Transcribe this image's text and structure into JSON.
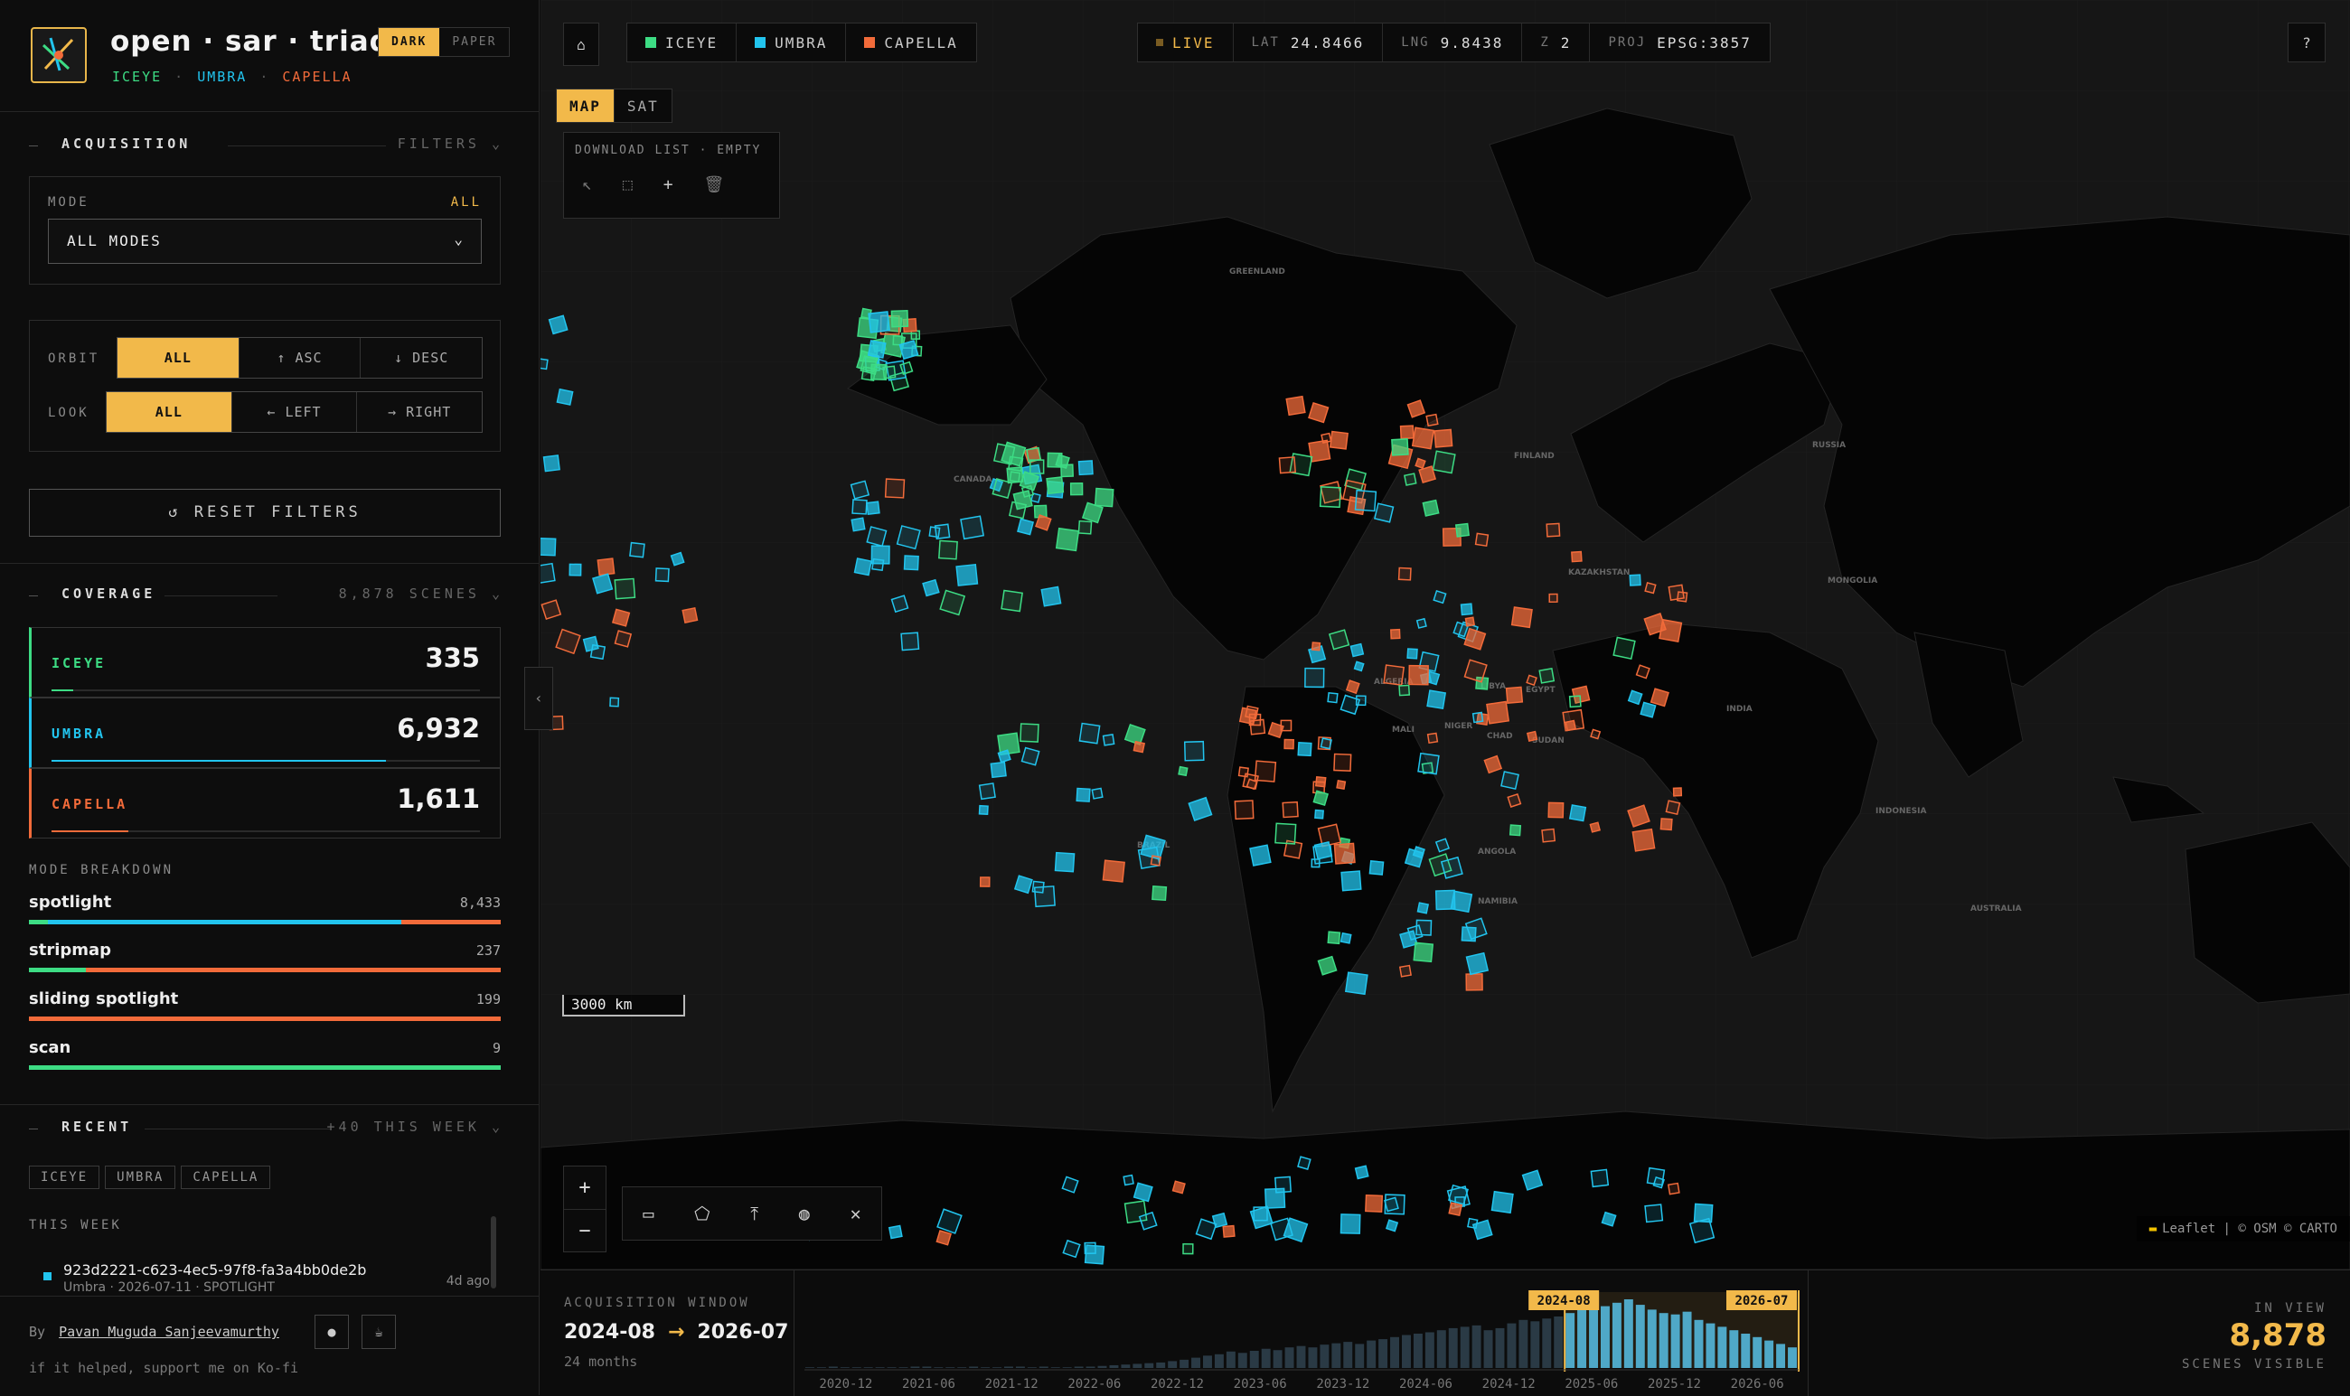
{
  "app": {
    "title": "open · sar · triad",
    "theme_dark": "DARK",
    "theme_paper": "PAPER",
    "providers": [
      "ICEYE",
      "UMBRA",
      "CAPELLA"
    ]
  },
  "colors": {
    "iceye": "#3ddc84",
    "umbra": "#22c4ee",
    "capella": "#f26b3a",
    "accent": "#f2b94a"
  },
  "acquisition": {
    "header": "ACQUISITION",
    "filters": "FILTERS",
    "mode_label": "MODE",
    "mode_all": "ALL",
    "mode_value": "ALL MODES",
    "orbit_label": "ORBIT",
    "orbit_options": [
      "ALL",
      "↑ ASC",
      "↓ DESC"
    ],
    "look_label": "LOOK",
    "look_options": [
      "ALL",
      "← LEFT",
      "→ RIGHT"
    ],
    "reset": "↺ RESET FILTERS"
  },
  "coverage": {
    "header": "COVERAGE",
    "scenes": "8,878 SCENES",
    "rows": [
      {
        "name": "ICEYE",
        "value": "335"
      },
      {
        "name": "UMBRA",
        "value": "6,932"
      },
      {
        "name": "CAPELLA",
        "value": "1,611"
      }
    ]
  },
  "modes": {
    "header": "MODE BREAKDOWN",
    "rows": [
      {
        "name": "spotlight",
        "value": "8,433"
      },
      {
        "name": "stripmap",
        "value": "237"
      },
      {
        "name": "sliding spotlight",
        "value": "199"
      },
      {
        "name": "scan",
        "value": "9"
      }
    ]
  },
  "recent": {
    "header": "RECENT",
    "week": "+40 THIS WEEK",
    "chips": [
      "ICEYE",
      "UMBRA",
      "CAPELLA"
    ],
    "section": "THIS WEEK",
    "item": {
      "id": "923d2221-c623-4ec5-97f8-fa3a4bb0de2b",
      "meta": "Umbra · 2026-07-11 · SPOTLIGHT",
      "ago": "4d ago"
    }
  },
  "footer": {
    "by": "By",
    "author": "Pavan Muguda Sanjeevamurthy",
    "support": "if it helped, support me on Ko-fi"
  },
  "map": {
    "layers": [
      "ICEYE",
      "UMBRA",
      "CAPELLA"
    ],
    "live": "LIVE",
    "lat_label": "LAT",
    "lat": "24.8466",
    "lng_label": "LNG",
    "lng": "9.8438",
    "z_label": "Z",
    "z": "2",
    "proj_label": "PROJ",
    "proj": "EPSG:3857",
    "basemap": [
      "MAP",
      "SAT"
    ],
    "download": "DOWNLOAD LIST · EMPTY",
    "scale": "3000 km",
    "attribution": "Leaflet | © OSM © CARTO",
    "help": "?",
    "labels": [
      [
        "GREENLAND",
        1360,
        303
      ],
      [
        "RUSSIA",
        2005,
        495
      ],
      [
        "CANADA",
        1055,
        533
      ],
      [
        "KAZAKHSTAN",
        1735,
        636
      ],
      [
        "MONGOLIA",
        2022,
        645
      ],
      [
        "ALGERIA",
        1520,
        757
      ],
      [
        "LIBYA",
        1638,
        762
      ],
      [
        "EGYPT",
        1688,
        766
      ],
      [
        "MALI",
        1540,
        810
      ],
      [
        "NIGER",
        1598,
        806
      ],
      [
        "CHAD",
        1645,
        817
      ],
      [
        "SUDAN",
        1695,
        822
      ],
      [
        "INDIA",
        1910,
        787
      ],
      [
        "INDONESIA",
        2075,
        900
      ],
      [
        "BRAZIL",
        1258,
        938
      ],
      [
        "ANGOLA",
        1635,
        945
      ],
      [
        "AUSTRALIA",
        2180,
        1008
      ],
      [
        "FINLAND",
        1675,
        507
      ],
      [
        "NAMIBIA",
        1635,
        1000
      ]
    ]
  },
  "timeline": {
    "label": "ACQUISITION WINDOW",
    "start": "2024-08",
    "end": "2026-07",
    "months": "24 months",
    "in_view": "IN VIEW",
    "count": "8,878",
    "scenes": "SCENES VISIBLE",
    "ticks": [
      "2020-12",
      "2021-06",
      "2021-12",
      "2022-06",
      "2022-12",
      "2023-06",
      "2023-12",
      "2024-06",
      "2024-12",
      "2025-06",
      "2025-12",
      "2026-06"
    ],
    "bars": [
      1,
      1,
      2,
      1,
      1,
      1,
      1,
      1,
      1,
      2,
      2,
      1,
      1,
      1,
      2,
      1,
      1,
      2,
      2,
      1,
      2,
      1,
      1,
      2,
      2,
      3,
      4,
      5,
      6,
      7,
      8,
      10,
      12,
      15,
      18,
      20,
      24,
      22,
      25,
      28,
      26,
      30,
      32,
      30,
      34,
      36,
      38,
      35,
      40,
      42,
      45,
      48,
      50,
      52,
      55,
      58,
      60,
      62,
      55,
      58,
      65,
      70,
      68,
      72,
      75,
      80,
      85,
      88,
      90,
      95,
      100,
      92,
      85,
      80,
      78,
      82,
      70,
      65,
      60,
      55,
      50,
      45,
      40,
      35,
      30
    ]
  }
}
